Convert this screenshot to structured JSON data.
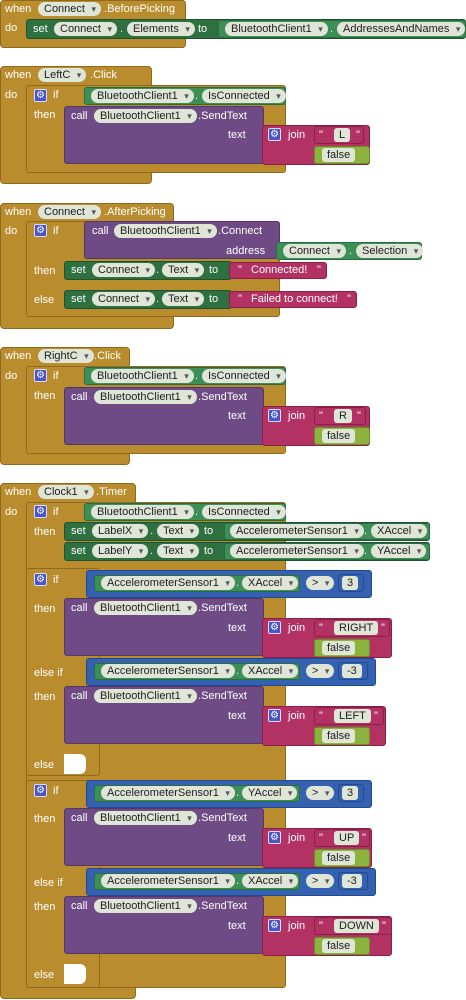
{
  "kw": {
    "when": "when",
    "do": "do",
    "if": "if",
    "then": "then",
    "else": "else",
    "elseif": "else if",
    "set": "set",
    "to": "to",
    "call": "call",
    "text_param": "text",
    "address_param": "address",
    "join": "join",
    "false": "false",
    "dot": "."
  },
  "comp": {
    "Connect": "Connect",
    "LeftC": "LeftC",
    "RightC": "RightC",
    "Clock1": "Clock1",
    "Bluetooth": "BluetoothClient1",
    "Accel": "AccelerometerSensor1",
    "LabelX": "LabelX",
    "LabelY": "LabelY"
  },
  "prop": {
    "BeforePicking": "BeforePicking",
    "Elements": "Elements",
    "AddressesAndNames": "AddressesAndNames",
    "Click": "Click",
    "IsConnected": "IsConnected",
    "SendText": "SendText",
    "AfterPicking": "AfterPicking",
    "ConnectM": "Connect",
    "Selection": "Selection",
    "Text": "Text",
    "Timer": "Timer",
    "XAccel": "XAccel",
    "YAccel": "YAccel"
  },
  "str": {
    "L": "L",
    "R": "R",
    "Connected": "Connected!",
    "Failed": "Failed to connect!",
    "RIGHT": "RIGHT",
    "LEFT": "LEFT",
    "UP": "UP",
    "DOWN": "DOWN"
  },
  "math": {
    "gt": ">",
    "three": "3",
    "neg_three": "-3"
  },
  "icons": {
    "mutator": "gear-icon"
  }
}
